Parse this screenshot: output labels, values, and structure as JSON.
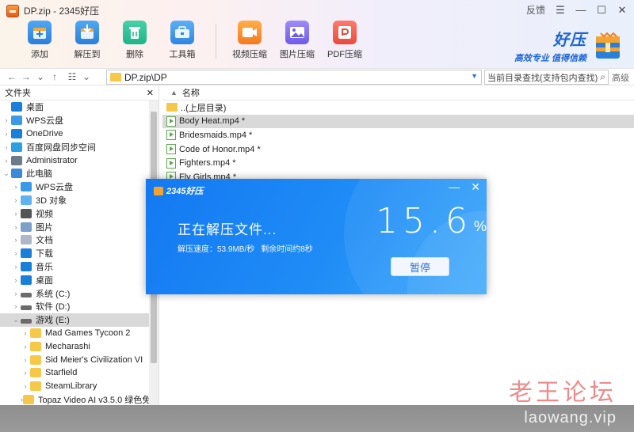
{
  "window": {
    "title": "DP.zip - 2345好压",
    "feedback": "反馈"
  },
  "toolbar": {
    "add": "添加",
    "extract_to": "解压到",
    "delete": "删除",
    "toolbox": "工具箱",
    "video_compress": "视频压缩",
    "image_compress": "图片压缩",
    "pdf_compress": "PDF压缩"
  },
  "brand": {
    "name": "好压",
    "slogan": "高效专业 值得信赖"
  },
  "navigation": {
    "path": "DP.zip\\DP",
    "search_placeholder": "当前目录查找(支持包内查找)",
    "advanced": "高级"
  },
  "left_pane": {
    "header": "文件夹",
    "items": [
      {
        "label": "桌面",
        "icon": "desktop-icon"
      },
      {
        "label": "WPS云盘",
        "icon": "cloud-icon"
      },
      {
        "label": "OneDrive",
        "icon": "cloud-icon"
      },
      {
        "label": "百度网盘同步空间",
        "icon": "sync-icon"
      },
      {
        "label": "Administrator",
        "icon": "user-icon"
      },
      {
        "label": "此电脑",
        "icon": "computer-icon"
      },
      {
        "label": "WPS云盘",
        "icon": "cloud-icon"
      },
      {
        "label": "3D 对象",
        "icon": "cube-icon"
      },
      {
        "label": "视频",
        "icon": "video-icon"
      },
      {
        "label": "图片",
        "icon": "picture-icon"
      },
      {
        "label": "文档",
        "icon": "document-icon"
      },
      {
        "label": "下载",
        "icon": "download-icon"
      },
      {
        "label": "音乐",
        "icon": "music-icon"
      },
      {
        "label": "桌面",
        "icon": "desktop-icon"
      },
      {
        "label": "系统 (C:)",
        "icon": "drive-icon"
      },
      {
        "label": "软件 (D:)",
        "icon": "drive-icon"
      },
      {
        "label": "游戏 (E:)",
        "icon": "drive-icon"
      },
      {
        "label": "Mad Games Tycoon 2",
        "icon": "folder-icon"
      },
      {
        "label": "Mecharashi",
        "icon": "folder-icon"
      },
      {
        "label": "Sid Meier's Civilization VI",
        "icon": "folder-icon"
      },
      {
        "label": "Starfield",
        "icon": "folder-icon"
      },
      {
        "label": "SteamLibrary",
        "icon": "folder-icon"
      },
      {
        "label": "Topaz Video AI v3.5.0 绿色免",
        "icon": "folder-icon"
      }
    ]
  },
  "file_list": {
    "column_name": "名称",
    "rows": [
      {
        "name": "..(上层目录)",
        "type": "folder"
      },
      {
        "name": "Body Heat.mp4 *",
        "type": "mp4"
      },
      {
        "name": "Bridesmaids.mp4 *",
        "type": "mp4"
      },
      {
        "name": "Code of Honor.mp4 *",
        "type": "mp4"
      },
      {
        "name": "Fighters.mp4 *",
        "type": "mp4"
      },
      {
        "name": "Fly Girls.mp4 *",
        "type": "mp4"
      }
    ]
  },
  "dialog": {
    "logo_text": "2345好压",
    "title": "正在解压文件...",
    "speed": "解压速度：53.9MB/秒",
    "remaining": "剩余时间约8秒",
    "percent": "15.6",
    "percent_sign": "%",
    "pause_button": "暂停"
  },
  "watermark": {
    "line1": "老王论坛",
    "line2": "laowang.vip"
  },
  "colors": {
    "dialog_blue": "#1f8cf6",
    "selection_gray": "#d9d9d9",
    "folder_yellow": "#f5c84a",
    "brand_blue": "#1a64d6"
  }
}
